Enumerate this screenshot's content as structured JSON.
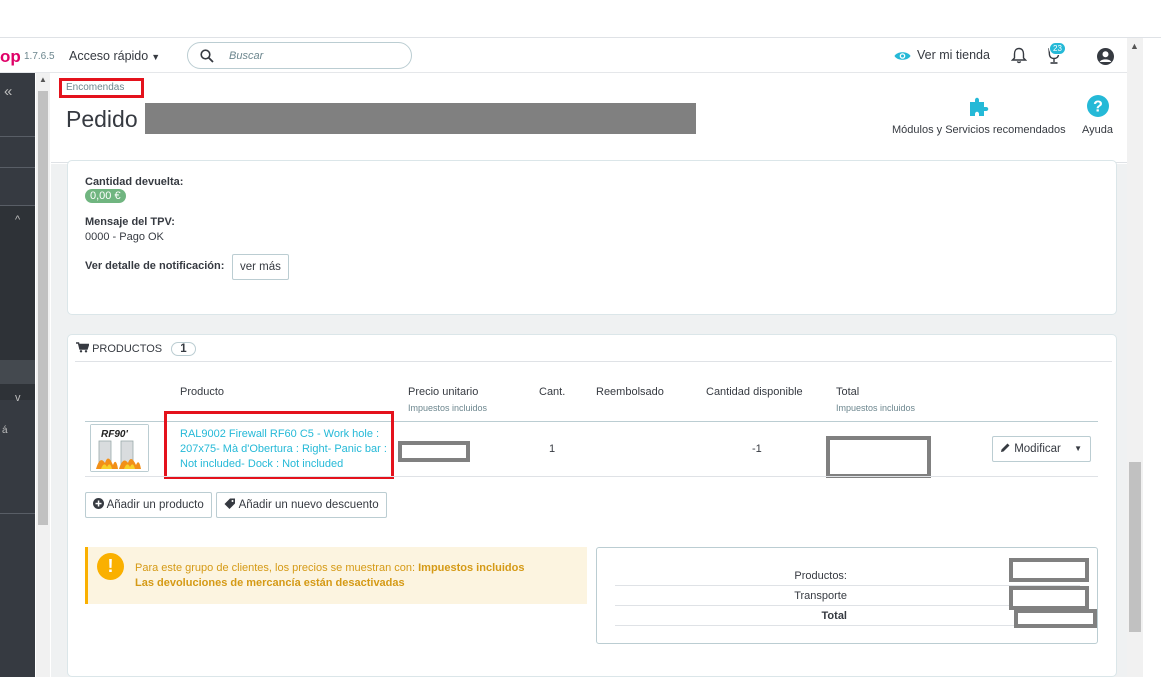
{
  "header": {
    "logo_fragment": "op",
    "version": "1.7.6.5",
    "quick_access": "Acceso rápido",
    "search_placeholder": "Buscar",
    "view_shop": "Ver mi tienda",
    "notifications_count": "23"
  },
  "page": {
    "breadcrumb": "Encomendas",
    "title": "Pedido",
    "toolbar": {
      "modules_label": "Módulos y Servicios recomendados",
      "help_label": "Ayuda"
    }
  },
  "payment": {
    "returned_label": "Cantidad devuelta:",
    "returned_value": "0,00 €",
    "tpv_label": "Mensaje del TPV:",
    "tpv_value": "0000 - Pago OK",
    "notification_label": "Ver detalle de notificación:",
    "see_more": "ver más"
  },
  "products": {
    "section_title": "PRODUCTOS",
    "count": "1",
    "columns": {
      "product": "Producto",
      "unit_price": "Precio unitario",
      "unit_price_sub": "Impuestos incluidos",
      "qty": "Cant.",
      "refunded": "Reembolsado",
      "available": "Cantidad disponible",
      "total": "Total",
      "total_sub": "Impuestos incluidos"
    },
    "rows": [
      {
        "thumb_text": "RF90'",
        "name": "RAL9002 Firewall RF60 C5 - Work hole : 207x75- Mà d'Obertura : Right- Panic bar : Not included- Dock : Not included",
        "qty": "1",
        "available": "-1",
        "modify_label": "Modificar"
      }
    ],
    "add_product": "Añadir un producto",
    "add_discount": "Añadir un nuevo descuento"
  },
  "alert": {
    "line1_prefix": "Para este grupo de clientes, los precios se muestran con:",
    "line1_bold": "Impuestos incluidos",
    "line2": "Las devoluciones de mercancía están desactivadas"
  },
  "totals": {
    "products_label": "Productos:",
    "shipping_label": "Transporte",
    "total_label": "Total"
  },
  "colors": {
    "accent": "#25b9d7",
    "brand": "#df0067",
    "highlight_red": "#e4121c",
    "success": "#70b580",
    "warning": "#fab000"
  }
}
